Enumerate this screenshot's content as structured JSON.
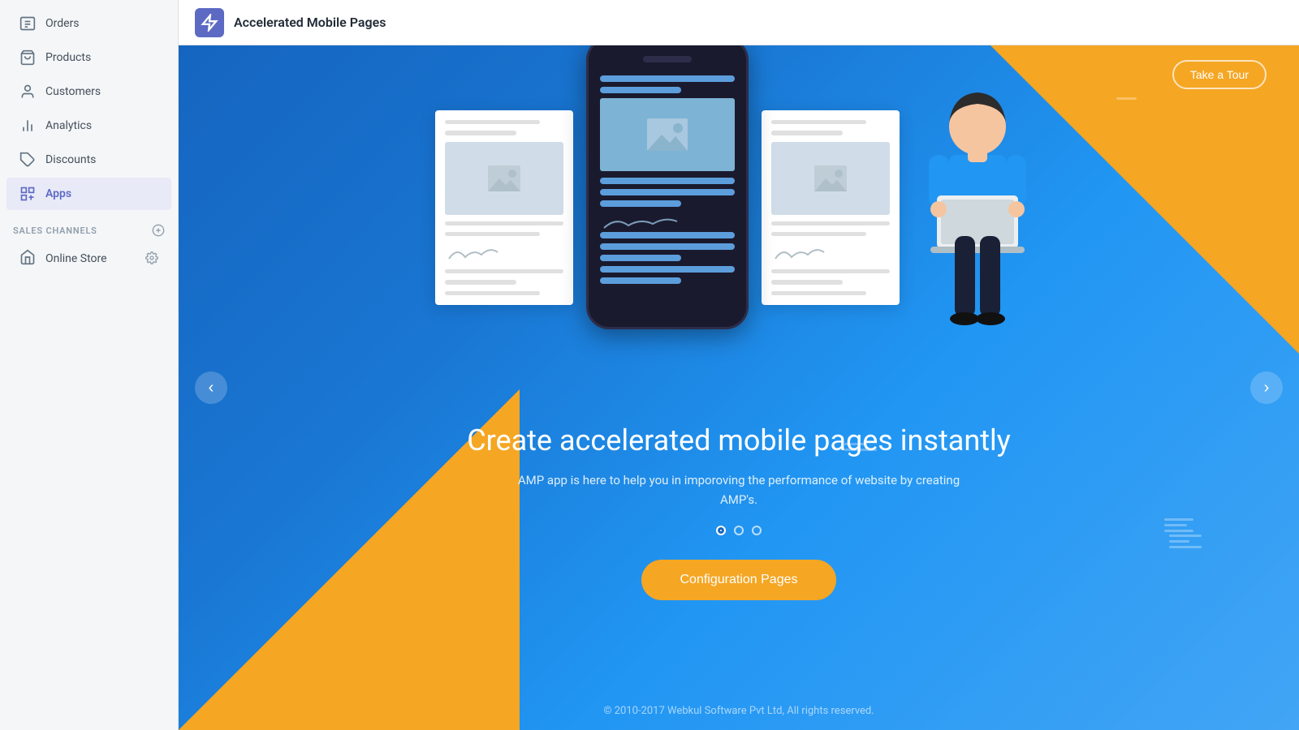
{
  "sidebar": {
    "items": [
      {
        "id": "orders",
        "label": "Orders",
        "icon": "📦"
      },
      {
        "id": "products",
        "label": "Products",
        "icon": "🛍"
      },
      {
        "id": "customers",
        "label": "Customers",
        "icon": "👤"
      },
      {
        "id": "analytics",
        "label": "Analytics",
        "icon": "📊"
      },
      {
        "id": "discounts",
        "label": "Discounts",
        "icon": "🏷"
      },
      {
        "id": "apps",
        "label": "Apps",
        "icon": "⊞",
        "active": true
      }
    ],
    "sales_channels_header": "SALES CHANNELS",
    "channels": [
      {
        "id": "online-store",
        "label": "Online Store"
      }
    ]
  },
  "header": {
    "app_name": "Accelerated Mobile Pages",
    "logo_symbol": "⚡"
  },
  "hero": {
    "take_tour_label": "Take a Tour",
    "title": "Create accelerated mobile pages instantly",
    "subtitle_line1": "AMP app is here to help you in imporoving the performance of website by creating",
    "subtitle_line2": "AMP's.",
    "config_btn_label": "Configuration Pages",
    "footer_text": "© 2010-2017 Webkul Software Pvt Ltd, All rights reserved."
  },
  "dots": [
    {
      "active": true
    },
    {
      "active": false
    },
    {
      "active": false
    }
  ]
}
